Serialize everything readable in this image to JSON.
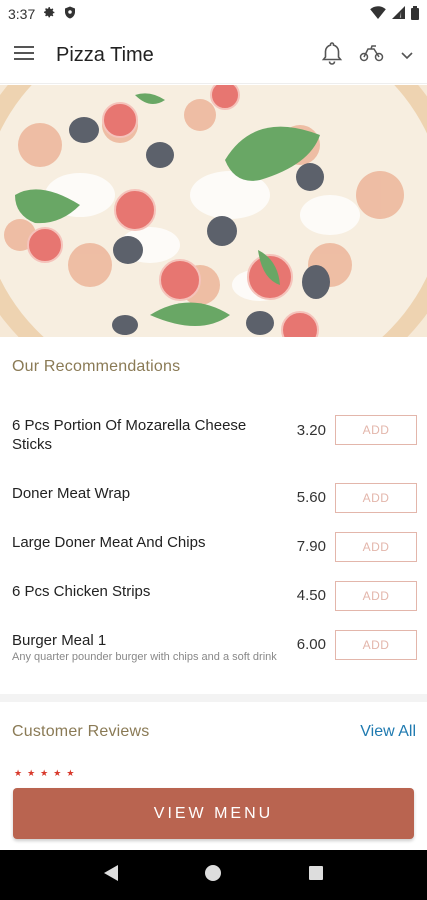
{
  "status": {
    "time": "3:37"
  },
  "app": {
    "title": "Pizza Time"
  },
  "recommendations": {
    "title": "Our Recommendations",
    "items": [
      {
        "name": "6 Pcs Portion Of Mozarella Cheese Sticks",
        "description": "",
        "price": "3.20",
        "button": "ADD"
      },
      {
        "name": "Doner Meat Wrap",
        "description": "",
        "price": "5.60",
        "button": "ADD"
      },
      {
        "name": "Large Doner Meat And Chips",
        "description": "",
        "price": "7.90",
        "button": "ADD"
      },
      {
        "name": " 6 Pcs Chicken Strips",
        "description": "",
        "price": "4.50",
        "button": "ADD"
      },
      {
        "name": "Burger Meal 1",
        "description": "Any quarter pounder burger with chips and a soft drink",
        "price": "6.00",
        "button": "ADD"
      }
    ]
  },
  "reviews": {
    "title": "Customer Reviews",
    "view_all": "View All",
    "rating": 5
  },
  "cta": {
    "view_menu": "VIEW MENU"
  },
  "colors": {
    "accent": "#b96450",
    "section_title": "#8a7a55",
    "link": "#1f7ab0",
    "add_border": "#e3b6ab",
    "star": "#d8392b"
  }
}
